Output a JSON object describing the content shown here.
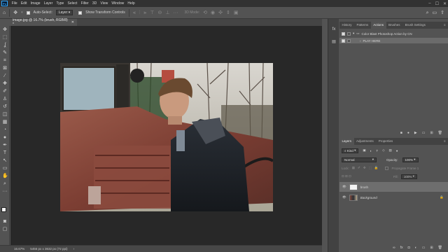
{
  "menubar": {
    "items": [
      "File",
      "Edit",
      "Image",
      "Layer",
      "Type",
      "Select",
      "Filter",
      "3D",
      "View",
      "Window",
      "Help"
    ]
  },
  "options": {
    "auto_select": "Auto-Select:",
    "layer_select": "Layer",
    "transform": "Show Transform Controls",
    "mode3d": "3D Mode:"
  },
  "document": {
    "tab_title": "image.jpg @ 16.7% (brush, RGB/8) *"
  },
  "status": {
    "zoom": "16.67%",
    "size": "5456 px x 3632 px (72 ppi)"
  },
  "actions_panel": {
    "tabs": [
      "History",
      "Patterns",
      "Actions",
      "Brushes",
      "Brush Settings"
    ],
    "active_tab": "Actions",
    "set_name": "Color Blast Photoshop Action by CN",
    "action_name": "PLAY HERE"
  },
  "layers_panel": {
    "tabs": [
      "Layers",
      "Adjustments",
      "Properties"
    ],
    "active_tab": "Layers",
    "kind": "Kind",
    "blend_mode": "Normal",
    "opacity_label": "Opacity:",
    "opacity_value": "100%",
    "lock_label": "Lock:",
    "propagate": "Propagate Frame 1",
    "fill_label": "Fill:",
    "fill_value": "100%",
    "layers": [
      {
        "name": "brush"
      },
      {
        "name": "Background"
      }
    ]
  },
  "colors": {
    "accent": "#31a8ff",
    "canvas_bg": "#282828",
    "panel_bg": "#535353",
    "tab_bg": "#424242"
  }
}
